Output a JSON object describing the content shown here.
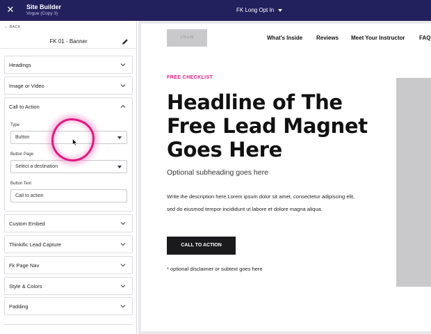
{
  "topbar": {
    "app_title": "Site Builder",
    "app_subtitle": "Vogue (Copy 3)",
    "page_select": "FK Long Opt In"
  },
  "sidebar": {
    "back_label": "BACK",
    "section_title": "FK 01 - Banner",
    "panels": [
      {
        "label": "Headings",
        "expanded": false
      },
      {
        "label": "Image or Video",
        "expanded": false
      },
      {
        "label": "Call to Action",
        "expanded": true
      },
      {
        "label": "Custom Embed",
        "expanded": false
      },
      {
        "label": "Thinkific Lead Capture",
        "expanded": false
      },
      {
        "label": "Fk Page Nav",
        "expanded": false
      },
      {
        "label": "Style & Colors",
        "expanded": false
      },
      {
        "label": "Padding",
        "expanded": false
      }
    ],
    "cta": {
      "type_label": "Type",
      "type_value": "Button",
      "page_label": "Button Page",
      "page_value": "Select a destination",
      "text_label": "Button Text",
      "text_value": "Call to action"
    }
  },
  "preview": {
    "logo_placeholder": "175 x 50",
    "nav": [
      "What's Inside",
      "Reviews",
      "Meet Your Instructor",
      "FAQ"
    ],
    "eyebrow": "FREE CHECKLIST",
    "headline": "Headline of The Free Lead Magnet Goes Here",
    "subheading": "Optional subheading goes here",
    "description": "Write the description here.Lorem ipsum dolor sit amet, consectetur adipiscing elit, sed do eiusmod tempor incididunt ut labore et dolore magna aliqua.",
    "cta_label": "CALL TO ACTION",
    "disclaimer": "* optional disclaimer or subtext goes here"
  },
  "colors": {
    "topbar": "#23205e",
    "accent": "#e0187f",
    "cta_button": "#1a1a1d",
    "placeholder": "#c9c9cc"
  }
}
